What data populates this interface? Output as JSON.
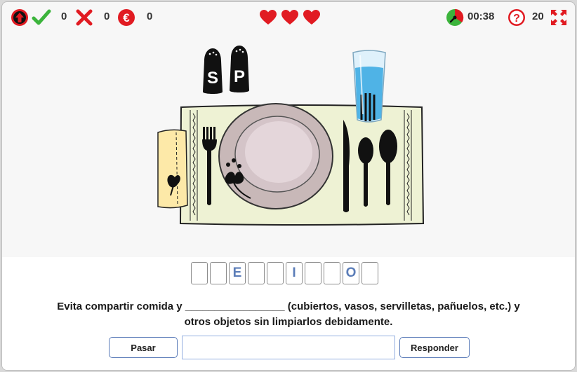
{
  "topbar": {
    "correct_count": "0",
    "wrong_count": "0",
    "coins_count": "0",
    "lives": 3,
    "timer": "00:38",
    "questions_left": "20",
    "icons": [
      "exit-icon",
      "check-icon",
      "cross-icon",
      "euro-icon",
      "heart-icon",
      "clock-icon",
      "question-icon",
      "fullscreen-icon"
    ]
  },
  "scene": {
    "salt_label": "S",
    "pepper_label": "P"
  },
  "puzzle": {
    "tiles": [
      "",
      "",
      "E",
      "",
      "",
      "I",
      "",
      "",
      "O",
      ""
    ],
    "sentence_line1": "Evita compartir comida y _________________ (cubiertos, vasos, servilletas, pañuelos, etc.) y",
    "sentence_line2": "otros objetos sin limpiarlos debidamente."
  },
  "controls": {
    "skip_label": "Pasar",
    "answer_value": "",
    "answer_placeholder": "",
    "submit_label": "Responder"
  },
  "colors": {
    "accent_blue": "#5a7bb8",
    "heart_red": "#e11b22",
    "check_green": "#3cb43c",
    "tablecloth": "#eef2d4"
  }
}
